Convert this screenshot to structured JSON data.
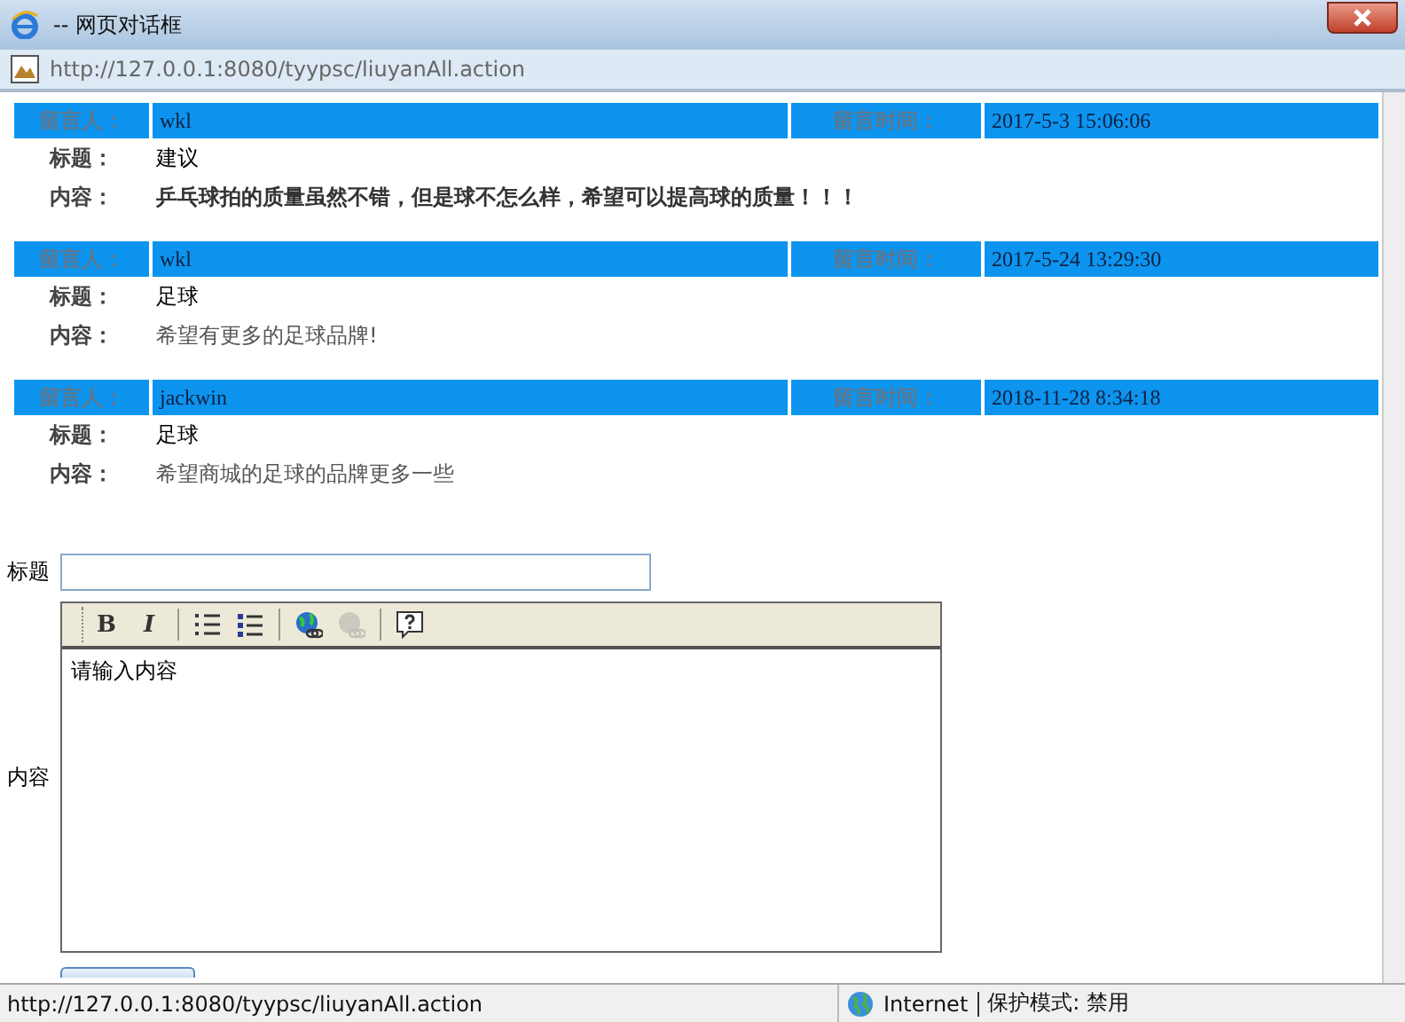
{
  "window": {
    "title": "-- 网页对话框",
    "address": "http://127.0.0.1:8080/tyypsc/liuyanAll.action"
  },
  "messages": [
    {
      "author_label": "留言人：",
      "author": "wkl",
      "time_label": "留言时间：",
      "time": "2017-5-3 15:06:06",
      "title_label": "标题：",
      "title": "建议",
      "content_label": "内容：",
      "content": "乒乓球拍的质量虽然不错，但是球不怎么样，希望可以提高球的质量！！！",
      "content_bold": true
    },
    {
      "author_label": "留言人：",
      "author": "wkl",
      "time_label": "留言时间：",
      "time": "2017-5-24 13:29:30",
      "title_label": "标题：",
      "title": "足球",
      "content_label": "内容：",
      "content": "希望有更多的足球品牌!",
      "content_bold": false
    },
    {
      "author_label": "留言人：",
      "author": "jackwin",
      "time_label": "留言时间：",
      "time": "2018-11-28 8:34:18",
      "title_label": "标题：",
      "title": "足球",
      "content_label": "内容：",
      "content": "希望商城的足球的品牌更多一些",
      "content_bold": false
    }
  ],
  "form": {
    "title_label": "标题",
    "content_label": "内容",
    "editor_value": "请输入内容",
    "toolbar": [
      {
        "kind": "bold",
        "label": "B",
        "disabled": false
      },
      {
        "kind": "italic",
        "label": "I",
        "disabled": false
      },
      {
        "kind": "separator"
      },
      {
        "kind": "ordered-list",
        "disabled": false
      },
      {
        "kind": "unordered-list",
        "disabled": false
      },
      {
        "kind": "separator"
      },
      {
        "kind": "link",
        "disabled": false
      },
      {
        "kind": "unlink",
        "disabled": true
      },
      {
        "kind": "separator"
      },
      {
        "kind": "help",
        "disabled": false
      }
    ]
  },
  "status_bar": {
    "url": "http://127.0.0.1:8080/tyypsc/liuyanAll.action",
    "zone": "Internet",
    "protected_mode": "保护模式: 禁用"
  }
}
